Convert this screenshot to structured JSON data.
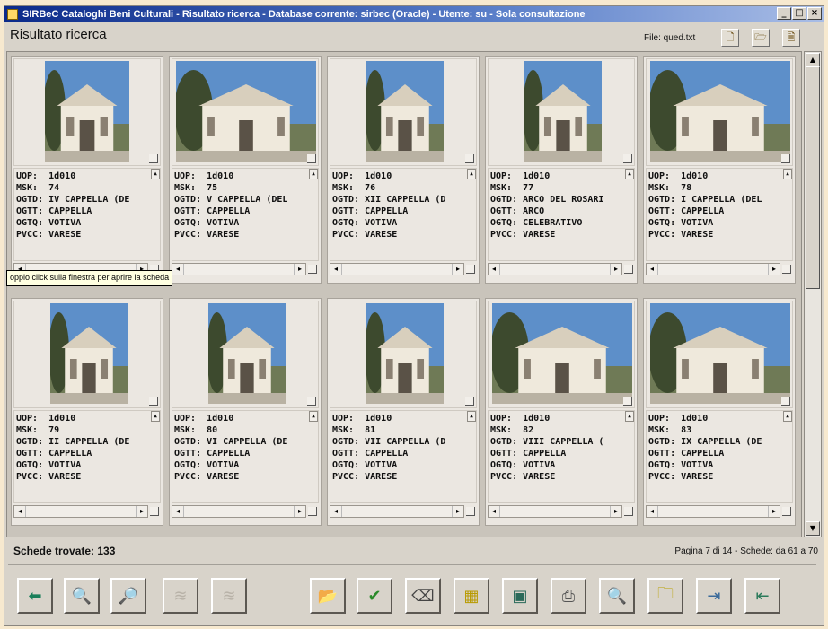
{
  "window": {
    "title": "SIRBeC Cataloghi Beni Culturali - Risultato ricerca - Database corrente: sirbec (Oracle) - Utente: su - Sola consultazione",
    "buttons": {
      "minimize": "_",
      "maximize": "□",
      "close": "×"
    }
  },
  "header": {
    "title": "Risultato ricerca",
    "file_label": "File: qued.txt"
  },
  "records": [
    {
      "lines": [
        "UOP:  1d010",
        "MSK:  74",
        "OGTD: IV CAPPELLA (DE",
        "OGTT: CAPPELLA",
        "OGTQ: VOTIVA",
        "PVCC: VARESE"
      ]
    },
    {
      "lines": [
        "UOP:  1d010",
        "MSK:  75",
        "OGTD: V CAPPELLA (DEL",
        "OGTT: CAPPELLA",
        "OGTQ: VOTIVA",
        "PVCC: VARESE"
      ]
    },
    {
      "lines": [
        "UOP:  1d010",
        "MSK:  76",
        "OGTD: XII CAPPELLA (D",
        "OGTT: CAPPELLA",
        "OGTQ: VOTIVA",
        "PVCC: VARESE"
      ]
    },
    {
      "lines": [
        "UOP:  1d010",
        "MSK:  77",
        "OGTD: ARCO DEL ROSARI",
        "OGTT: ARCO",
        "OGTQ: CELEBRATIVO",
        "PVCC: VARESE"
      ]
    },
    {
      "lines": [
        "UOP:  1d010",
        "MSK:  78",
        "OGTD: I CAPPELLA (DEL",
        "OGTT: CAPPELLA",
        "OGTQ: VOTIVA",
        "PVCC: VARESE"
      ]
    },
    {
      "lines": [
        "UOP:  1d010",
        "MSK:  79",
        "OGTD: II CAPPELLA (DE",
        "OGTT: CAPPELLA",
        "OGTQ: VOTIVA",
        "PVCC: VARESE"
      ]
    },
    {
      "lines": [
        "UOP:  1d010",
        "MSK:  80",
        "OGTD: VI CAPPELLA (DE",
        "OGTT: CAPPELLA",
        "OGTQ: VOTIVA",
        "PVCC: VARESE"
      ]
    },
    {
      "lines": [
        "UOP:  1d010",
        "MSK:  81",
        "OGTD: VII CAPPELLA (D",
        "OGTT: CAPPELLA",
        "OGTQ: VOTIVA",
        "PVCC: VARESE"
      ]
    },
    {
      "lines": [
        "UOP:  1d010",
        "MSK:  82",
        "OGTD: VIII CAPPELLA (",
        "OGTT: CAPPELLA",
        "OGTQ: VOTIVA",
        "PVCC: VARESE"
      ]
    },
    {
      "lines": [
        "UOP:  1d010",
        "MSK:  83",
        "OGTD: IX CAPPELLA (DE",
        "OGTT: CAPPELLA",
        "OGTQ: VOTIVA",
        "PVCC: VARESE"
      ]
    }
  ],
  "tooltip": "oppio click sulla finestra per aprire la scheda",
  "status": {
    "found": "Schede trovate: 133",
    "page": "Pagina 7 di 14 - Schede: da 61 a 70"
  },
  "toolbar": {
    "buttons": [
      {
        "icon": "back-arrow-icon",
        "glyph": "⬅"
      },
      {
        "icon": "search-map-icon",
        "glyph": "🔍"
      },
      {
        "icon": "search-map-alt-icon",
        "glyph": "🔎"
      },
      {
        "icon": "disabled-tool-icon",
        "glyph": "≋"
      },
      {
        "icon": "disabled-tool-alt-icon",
        "glyph": "≋"
      },
      {
        "icon": "folder-hand-icon",
        "glyph": "📂"
      },
      {
        "icon": "checkmark-icon",
        "glyph": "✔"
      },
      {
        "icon": "eraser-icon",
        "glyph": "⌫"
      },
      {
        "icon": "calculator-icon",
        "glyph": "▦"
      },
      {
        "icon": "image-view-icon",
        "glyph": "▣"
      },
      {
        "icon": "print-icon",
        "glyph": "⎙"
      },
      {
        "icon": "print-preview-icon",
        "glyph": "🔍"
      },
      {
        "icon": "folder-note-icon",
        "glyph": "🗀"
      },
      {
        "icon": "export-icon",
        "glyph": "⇥"
      },
      {
        "icon": "import-icon",
        "glyph": "⇤"
      }
    ]
  },
  "colors": {
    "accent": "#0b2a8a",
    "sky": "#4f8fd6",
    "building": "#efe9dc"
  }
}
